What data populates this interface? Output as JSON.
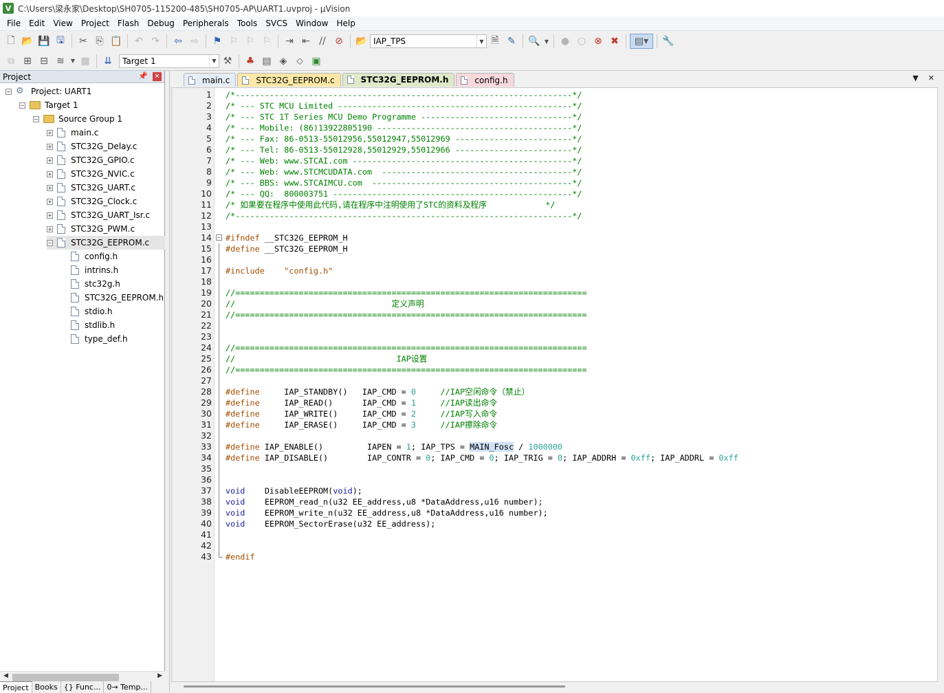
{
  "window": {
    "title": "C:\\Users\\梁永家\\Desktop\\SH0705-115200-485\\SH0705-AP\\UART1.uvproj - µVision",
    "app_icon": "V"
  },
  "menu": [
    "File",
    "Edit",
    "View",
    "Project",
    "Flash",
    "Debug",
    "Peripherals",
    "Tools",
    "SVCS",
    "Window",
    "Help"
  ],
  "toolbar": {
    "find_combo_value": "IAP_TPS",
    "target_combo_value": "Target 1"
  },
  "project_panel": {
    "title": "Project",
    "tree": [
      {
        "label": "Project: UART1",
        "level": 0,
        "kind": "project",
        "expander": "⊟"
      },
      {
        "label": "Target 1",
        "level": 1,
        "kind": "target",
        "expander": "⊟"
      },
      {
        "label": "Source Group 1",
        "level": 2,
        "kind": "folder",
        "expander": "⊟"
      },
      {
        "label": "main.c",
        "level": 3,
        "kind": "file",
        "expander": "+"
      },
      {
        "label": "STC32G_Delay.c",
        "level": 3,
        "kind": "file",
        "expander": "+"
      },
      {
        "label": "STC32G_GPIO.c",
        "level": 3,
        "kind": "file",
        "expander": "+"
      },
      {
        "label": "STC32G_NVIC.c",
        "level": 3,
        "kind": "file",
        "expander": "+"
      },
      {
        "label": "STC32G_UART.c",
        "level": 3,
        "kind": "file",
        "expander": "+"
      },
      {
        "label": "STC32G_Clock.c",
        "level": 3,
        "kind": "file",
        "expander": "+"
      },
      {
        "label": "STC32G_UART_Isr.c",
        "level": 3,
        "kind": "file",
        "expander": "+"
      },
      {
        "label": "STC32G_PWM.c",
        "level": 3,
        "kind": "file",
        "expander": "+"
      },
      {
        "label": "STC32G_EEPROM.c",
        "level": 3,
        "kind": "file",
        "expander": "-",
        "selected": true
      },
      {
        "label": "config.h",
        "level": 4,
        "kind": "file",
        "expander": ""
      },
      {
        "label": "intrins.h",
        "level": 4,
        "kind": "file",
        "expander": ""
      },
      {
        "label": "stc32g.h",
        "level": 4,
        "kind": "file",
        "expander": ""
      },
      {
        "label": "STC32G_EEPROM.h",
        "level": 4,
        "kind": "file",
        "expander": ""
      },
      {
        "label": "stdio.h",
        "level": 4,
        "kind": "file",
        "expander": ""
      },
      {
        "label": "stdlib.h",
        "level": 4,
        "kind": "file",
        "expander": ""
      },
      {
        "label": "type_def.h",
        "level": 4,
        "kind": "file",
        "expander": ""
      }
    ],
    "bottom_tabs": [
      "Project",
      "Books",
      "{} Func...",
      "0→ Temp..."
    ]
  },
  "editor_tabs": [
    {
      "label": "main.c",
      "style": "tab-main"
    },
    {
      "label": "STC32G_EEPROM.c",
      "style": "tab-eeprom-c"
    },
    {
      "label": "STC32G_EEPROM.h",
      "style": "tab-eeprom-h",
      "active": true
    },
    {
      "label": "config.h",
      "style": "tab-config"
    }
  ],
  "code": [
    [
      [
        "c",
        "/*---------------------------------------------------------------------*/"
      ]
    ],
    [
      [
        "c",
        "/* --- STC MCU Limited ------------------------------------------------*/"
      ]
    ],
    [
      [
        "c",
        "/* --- STC 1T Series MCU Demo Programme -------------------------------*/"
      ]
    ],
    [
      [
        "c",
        "/* --- Mobile: (86)13922805190 ----------------------------------------*/"
      ]
    ],
    [
      [
        "c",
        "/* --- Fax: 86-0513-55012956,55012947,55012969 ------------------------*/"
      ]
    ],
    [
      [
        "c",
        "/* --- Tel: 86-0513-55012928,55012929,55012966 ------------------------*/"
      ]
    ],
    [
      [
        "c",
        "/* --- Web: www.STCAI.com ---------------------------------------------*/"
      ]
    ],
    [
      [
        "c",
        "/* --- Web: www.STCMCUDATA.com  ---------------------------------------*/"
      ]
    ],
    [
      [
        "c",
        "/* --- BBS: www.STCAIMCU.com  -----------------------------------------*/"
      ]
    ],
    [
      [
        "c",
        "/* --- QQ:  800003751 -------------------------------------------------*/"
      ]
    ],
    [
      [
        "c",
        "/* 如果要在程序中使用此代码,请在程序中注明使用了STC的资料及程序            */"
      ]
    ],
    [
      [
        "c",
        "/*---------------------------------------------------------------------*/"
      ]
    ],
    [],
    [
      [
        "p",
        "#ifndef"
      ],
      [
        "t",
        " __STC32G_EEPROM_H"
      ]
    ],
    [
      [
        "p",
        "#define"
      ],
      [
        "t",
        " __STC32G_EEPROM_H"
      ]
    ],
    [],
    [
      [
        "p",
        "#include"
      ],
      [
        "t",
        "    "
      ],
      [
        "s",
        "\"config.h\""
      ]
    ],
    [],
    [
      [
        "c",
        "//========================================================================"
      ]
    ],
    [
      [
        "c",
        "//                                定义声明"
      ]
    ],
    [
      [
        "c",
        "//========================================================================"
      ]
    ],
    [],
    [],
    [
      [
        "c",
        "//========================================================================"
      ]
    ],
    [
      [
        "c",
        "//                                 IAP设置"
      ]
    ],
    [
      [
        "c",
        "//========================================================================"
      ]
    ],
    [],
    [
      [
        "p",
        "#define"
      ],
      [
        "t",
        "     IAP_STANDBY()   IAP_CMD = "
      ],
      [
        "n",
        "0"
      ],
      [
        "t",
        "     "
      ],
      [
        "c",
        "//IAP空闲命令（禁止）"
      ]
    ],
    [
      [
        "p",
        "#define"
      ],
      [
        "t",
        "     IAP_READ()      IAP_CMD = "
      ],
      [
        "n",
        "1"
      ],
      [
        "t",
        "     "
      ],
      [
        "c",
        "//IAP读出命令"
      ]
    ],
    [
      [
        "p",
        "#define"
      ],
      [
        "t",
        "     IAP_WRITE()     IAP_CMD = "
      ],
      [
        "n",
        "2"
      ],
      [
        "t",
        "     "
      ],
      [
        "c",
        "//IAP写入命令"
      ]
    ],
    [
      [
        "p",
        "#define"
      ],
      [
        "t",
        "     IAP_ERASE()     IAP_CMD = "
      ],
      [
        "n",
        "3"
      ],
      [
        "t",
        "     "
      ],
      [
        "c",
        "//IAP擦除命令"
      ]
    ],
    [],
    [
      [
        "p",
        "#define"
      ],
      [
        "t",
        " IAP_ENABLE()         IAPEN = "
      ],
      [
        "n",
        "1"
      ],
      [
        "t",
        "; IAP_TPS = "
      ],
      [
        "h",
        "MAIN_Fosc"
      ],
      [
        "t",
        " / "
      ],
      [
        "n",
        "1000000"
      ]
    ],
    [
      [
        "p",
        "#define"
      ],
      [
        "t",
        " IAP_DISABLE()        IAP_CONTR = "
      ],
      [
        "n",
        "0"
      ],
      [
        "t",
        "; IAP_CMD = "
      ],
      [
        "n",
        "0"
      ],
      [
        "t",
        "; IAP_TRIG = "
      ],
      [
        "n",
        "0"
      ],
      [
        "t",
        "; IAP_ADDRH = "
      ],
      [
        "n",
        "0xff"
      ],
      [
        "t",
        "; IAP_ADDRL = "
      ],
      [
        "n",
        "0xff"
      ]
    ],
    [],
    [],
    [
      [
        "k",
        "void"
      ],
      [
        "t",
        "    DisableEEPROM("
      ],
      [
        "k",
        "void"
      ],
      [
        "t",
        ");"
      ]
    ],
    [
      [
        "k",
        "void"
      ],
      [
        "t",
        "    EEPROM_read_n(u32 EE_address,u8 *DataAddress,u16 number);"
      ]
    ],
    [
      [
        "k",
        "void"
      ],
      [
        "t",
        "    EEPROM_write_n(u32 EE_address,u8 *DataAddress,u16 number);"
      ]
    ],
    [
      [
        "k",
        "void"
      ],
      [
        "t",
        "    EEPROM_SectorErase(u32 EE_address);"
      ]
    ],
    [],
    [],
    [
      [
        "p",
        "#endif"
      ]
    ]
  ],
  "colors": {
    "comment": "#008000",
    "preprocessor": "#a34e00",
    "keyword": "#1b1ba0",
    "number": "#2aa198",
    "highlight": "#cfe1f5"
  }
}
